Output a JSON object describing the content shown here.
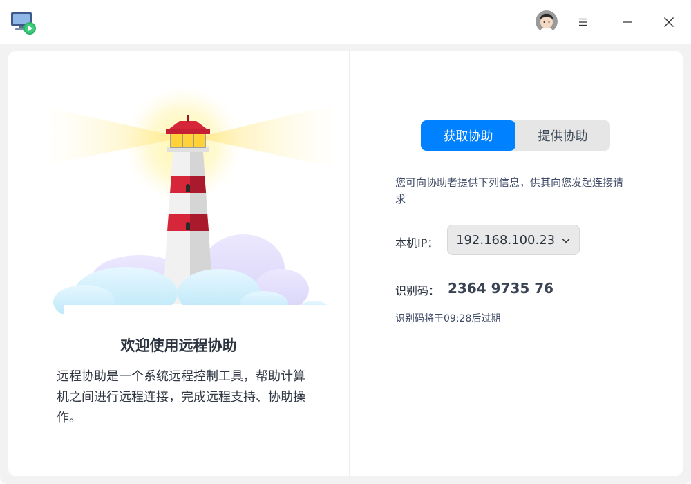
{
  "titlebar": {
    "app_icon": "remote-assistance-app-icon",
    "avatar": "user-avatar",
    "menu_icon": "hamburger-menu-icon",
    "minimize_icon": "minimize-icon",
    "close_icon": "close-icon"
  },
  "left": {
    "illustration": "lighthouse-illustration",
    "title": "欢迎使用远程协助",
    "description": "远程协助是一个系统远程控制工具，帮助计算机之间进行远程连接，完成远程支持、协助操作。"
  },
  "right": {
    "tabs": [
      {
        "label": "获取协助",
        "active": true
      },
      {
        "label": "提供协助",
        "active": false
      }
    ],
    "info": "您可向协助者提供下列信息，供其向您发起连接请求",
    "ip_label": "本机IP：",
    "ip_value": "192.168.100.23",
    "code_label": "识别码：",
    "code_value": "2364 9735 76",
    "expire_text": "识别码将于09:28后过期"
  },
  "colors": {
    "accent": "#0081ff",
    "lighthouse_red": "#d6263a"
  }
}
